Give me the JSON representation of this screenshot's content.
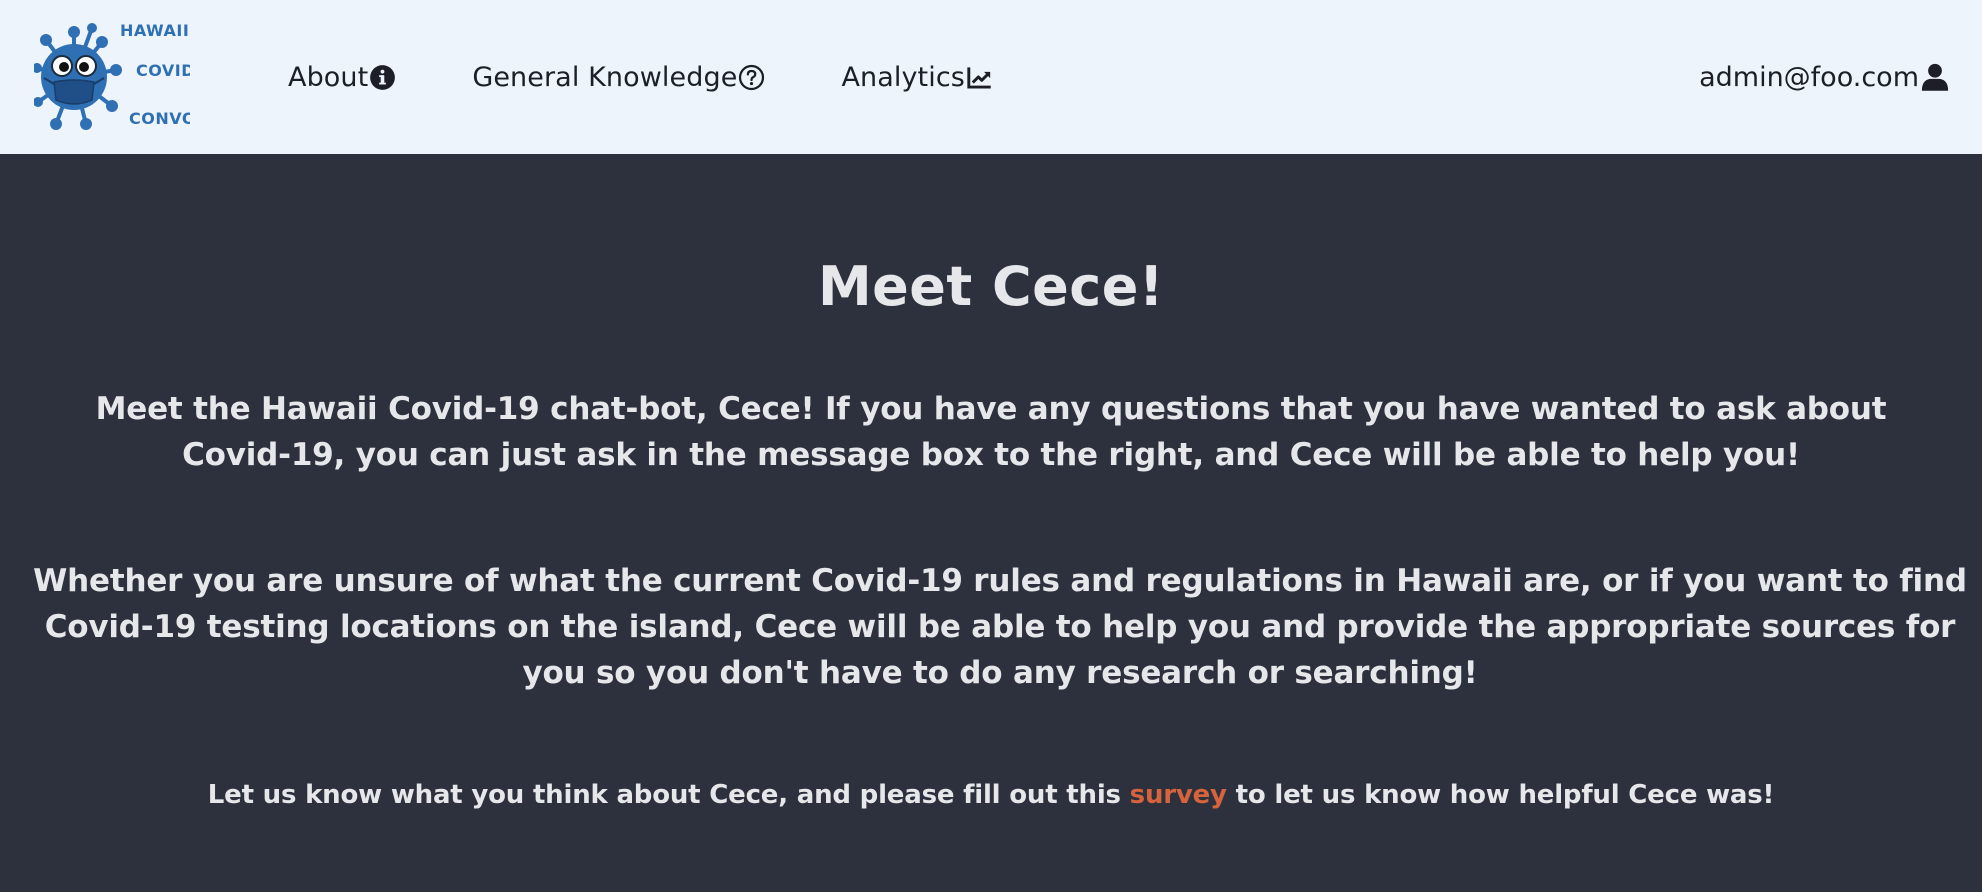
{
  "logo": {
    "text_line1": "HAWAII",
    "text_line2": "COVID",
    "text_line3": "CONVO"
  },
  "nav": {
    "items": [
      {
        "label": "About",
        "icon": "info-circle-icon"
      },
      {
        "label": "General Knowledge",
        "icon": "question-circle-icon"
      },
      {
        "label": "Analytics",
        "icon": "chart-line-icon"
      }
    ],
    "user": {
      "email": "admin@foo.com",
      "icon": "user-icon"
    }
  },
  "main": {
    "title": "Meet Cece!",
    "paragraph1": "Meet the Hawaii Covid-19 chat-bot, Cece! If you have any questions that you have wanted to ask about Covid-19, you can just ask in the message box to the right, and Cece will be able to help you!",
    "paragraph2": "Whether you are unsure of what the current Covid-19 rules and regulations in Hawaii are, or if you want to find Covid-19 testing locations on the island, Cece will be able to help you and provide the appropriate sources for you so you don't have to do any research or searching!",
    "survey": {
      "before": "Let us know what you think about Cece, and please fill out this ",
      "link": "survey",
      "after": " to let us know how helpful Cece was!"
    }
  },
  "colors": {
    "navbar_bg": "#eef4fc",
    "page_bg": "#2c313d",
    "text": "#e6e7ea",
    "link": "#d6633c",
    "logo_blue": "#2f6fb3"
  }
}
